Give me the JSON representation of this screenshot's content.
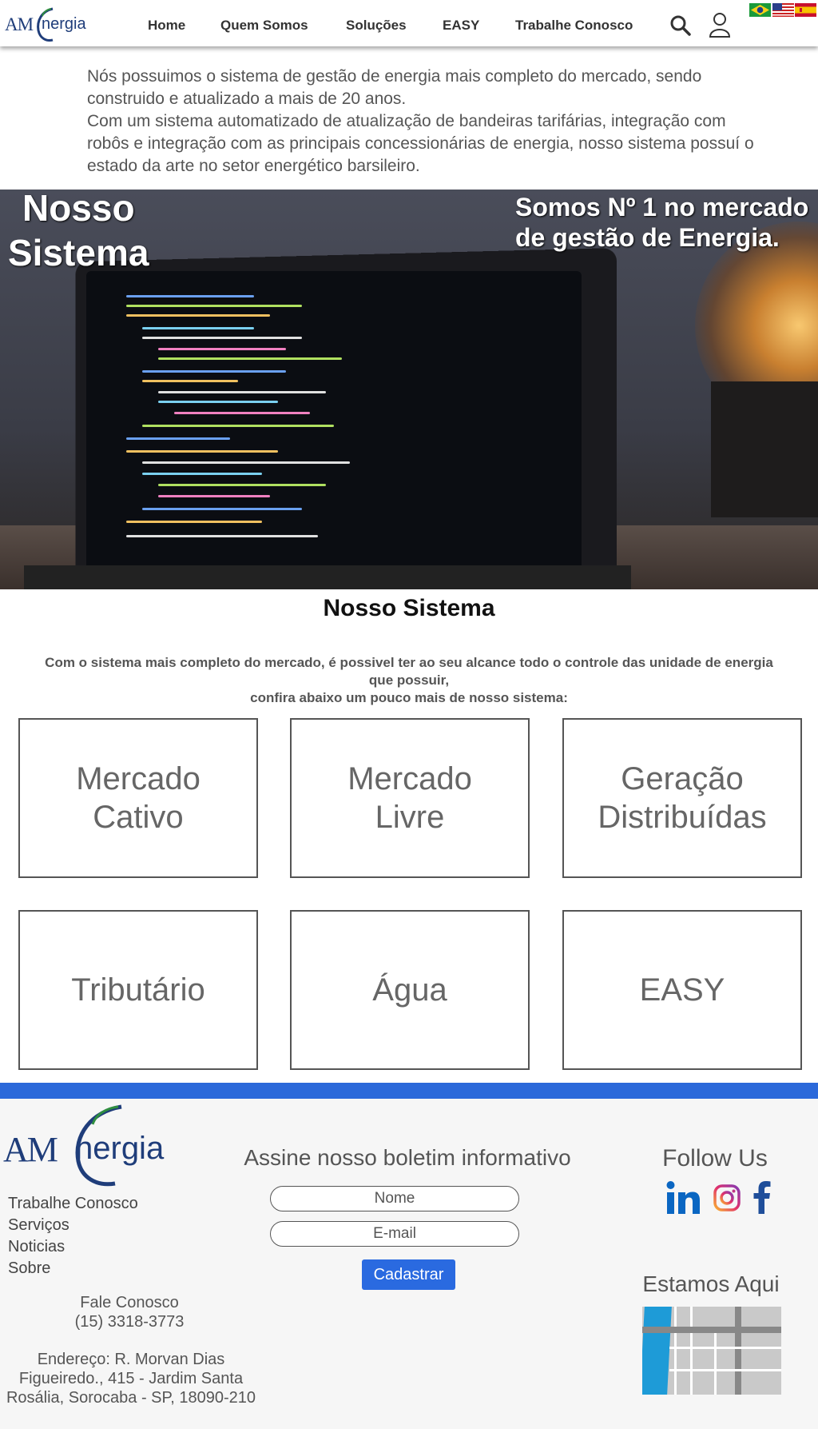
{
  "header": {
    "logo_am": "AM",
    "logo_energia": "nergia",
    "nav": [
      "Home",
      "Quem Somos",
      "Soluções",
      "EASY",
      "Trabalhe Conosco"
    ]
  },
  "intro": {
    "p1": "Nós possuimos o sistema de gestão de energia mais completo do mercado, sendo construido e atualizado a mais de 20 anos.",
    "p2": "Com um sistema automatizado de atualização de bandeiras tarifárias, integração com robôs e integração com as principais concessionárias de energia, nosso sistema possuí o estado da arte no setor energético barsileiro."
  },
  "hero": {
    "title_line1": "Nosso",
    "title_line2": "Sistema",
    "subtitle_line1": "Somos Nº 1 no mercado",
    "subtitle_line2": "de gestão de Energia."
  },
  "section": {
    "title": "Nosso Sistema",
    "desc_line1": "Com o sistema mais completo do mercado, é possivel ter ao seu alcance todo o controle das unidade de energia",
    "desc_line2": "que possuir,",
    "desc_line3": "confira abaixo um pouco mais de nosso sistema:"
  },
  "cards": [
    {
      "line1": "Mercado",
      "line2": "Cativo"
    },
    {
      "line1": "Mercado",
      "line2": "Livre"
    },
    {
      "line1": "Geração",
      "line2": "Distribuídas"
    },
    {
      "line1": "Tributário",
      "line2": ""
    },
    {
      "line1": "Água",
      "line2": ""
    },
    {
      "line1": "EASY",
      "line2": ""
    }
  ],
  "footer": {
    "logo_am": "AM",
    "logo_energia": "nergia",
    "links": [
      "Trabalhe Conosco",
      "Serviços",
      "Noticias",
      "Sobre"
    ],
    "contact_title": "Fale Conosco",
    "phone": "(15) 3318-3773",
    "address_line1": "Endereço: R. Morvan Dias",
    "address_line2": "Figueiredo., 415 - Jardim Santa",
    "address_line3": "Rosália, Sorocaba - SP, 18090-210",
    "newsletter_title": "Assine nosso boletim informativo",
    "name_placeholder": "Nome",
    "email_placeholder": "E-mail",
    "submit_label": "Cadastrar",
    "follow_title": "Follow Us",
    "location_title": "Estamos Aqui"
  },
  "colors": {
    "accent_blue": "#2b69da",
    "logo_blue": "#1f3d7a",
    "text_gray": "#555555"
  }
}
